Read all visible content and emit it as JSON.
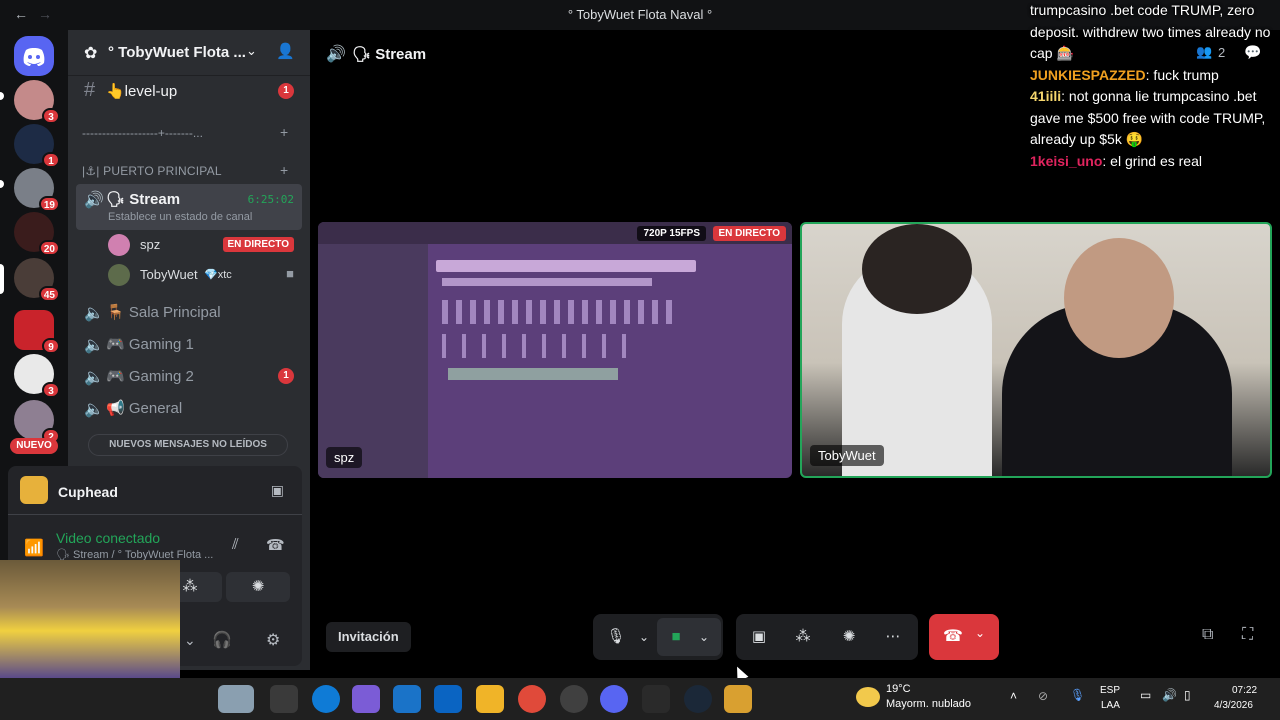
{
  "window": {
    "title": "° TobyWuet Flota Naval °"
  },
  "rail": {
    "badges": [
      "3",
      "1",
      "19",
      "20",
      "45",
      "9",
      "3",
      "2"
    ],
    "new_label": "NUEVO"
  },
  "guild": {
    "name": "° TobyWuet Flota ..."
  },
  "channels": {
    "level_up": {
      "label": "👆level-up",
      "badge": "1"
    },
    "divider_label": "-------------------+-------...",
    "category": "|⚓| PUERTO PRINCIPAL",
    "stream": {
      "label": "🗣 Stream",
      "timer": "6:25:02",
      "status": "Establece un estado de canal"
    },
    "voice_users": [
      {
        "name": "spz",
        "tag": "",
        "live": "EN DIRECTO"
      },
      {
        "name": "TobyWuet",
        "tag": "💎xtc",
        "live": ""
      }
    ],
    "voice_channels": [
      {
        "label": "🪑 Sala Principal",
        "badge": ""
      },
      {
        "label": "🎮 Gaming 1",
        "badge": ""
      },
      {
        "label": "🎮 Gaming 2",
        "badge": "1"
      },
      {
        "label": "📢 General",
        "badge": ""
      }
    ],
    "new_messages": "NUEVOS MENSAJES NO LEÍDOS"
  },
  "panel": {
    "game": "Cuphead",
    "vc_status": "Video conectado",
    "vc_sub": "🗣 Stream / ° TobyWuet Flota ..."
  },
  "stage": {
    "channel_name": "🗣 Stream",
    "tiles": [
      {
        "name": "spz",
        "quality": "720P 15FPS",
        "live": "EN DIRECTO"
      },
      {
        "name": "TobyWuet"
      }
    ],
    "invite_label": "Invitación"
  },
  "chat": {
    "viewers": "2",
    "messages": [
      {
        "author": "",
        "text": "trumpcasino .bet code TRUMP, zero deposit. withdrew two times already no cap 🎰",
        "color": "#ffffff"
      },
      {
        "author": "JUNKIESPAZZED",
        "text": ": fuck trump",
        "color": "#f0a020"
      },
      {
        "author": "41iili",
        "text": ": not gonna lie trumpcasino .bet gave me $500 free with code TRUMP, already up $5k 🤑",
        "color": "#f5d76e"
      },
      {
        "author": "1keisi_uno",
        "text": ": el grind es real",
        "color": "#e0245e"
      }
    ]
  },
  "taskbar": {
    "weather_temp": "19°C",
    "weather_desc": "Mayorm. nublado",
    "lang_1": "ESP",
    "lang_2": "LAA",
    "time": "07:22",
    "date": "4/3/2026"
  },
  "colors": {
    "accent_green": "#23a559",
    "danger_red": "#da373c",
    "sidebar_bg": "#2b2d31",
    "rail_bg": "#111214"
  }
}
